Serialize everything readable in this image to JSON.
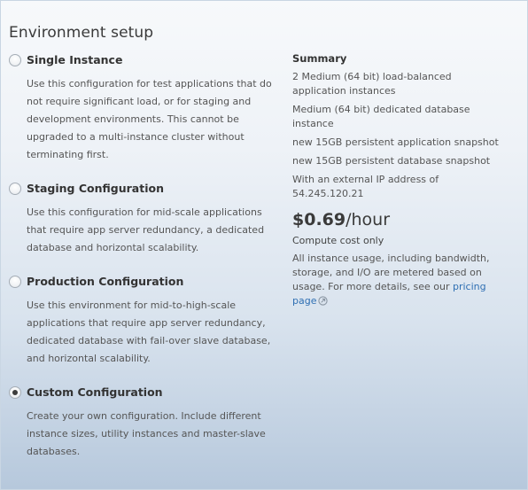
{
  "section": {
    "title": "Environment setup"
  },
  "options": [
    {
      "label": "Single Instance",
      "description": "Use this configuration for test applications that do not require significant load, or for staging and development environments. This cannot be upgraded to a multi-instance cluster without terminating first.",
      "selected": false
    },
    {
      "label": "Staging Configuration",
      "description": "Use this configuration for mid-scale applications that require app server redundancy, a dedicated database and horizontal scalability.",
      "selected": false
    },
    {
      "label": "Production Configuration",
      "description": "Use this environment for mid-to-high-scale applications that require app server redundancy, dedicated database with fail-over slave database, and horizontal scalability.",
      "selected": false
    },
    {
      "label": "Custom Configuration",
      "description": "Create your own configuration. Include different instance sizes, utility instances and master-slave databases.",
      "selected": true
    }
  ],
  "summary": {
    "heading": "Summary",
    "items": [
      "2 Medium (64 bit) load-balanced application instances",
      "Medium (64 bit) dedicated database instance",
      "new 15GB persistent application snapshot",
      "new 15GB persistent database snapshot",
      "With an external IP address of 54.245.120.21"
    ],
    "price": "$0.69",
    "price_unit": "/hour",
    "price_note": "Compute cost only",
    "usage_note": "All instance usage, including bandwidth, storage, and I/O are metered based on usage. For more details, see our ",
    "pricing_link": "pricing page",
    "link_color": "#2f6fb3"
  }
}
